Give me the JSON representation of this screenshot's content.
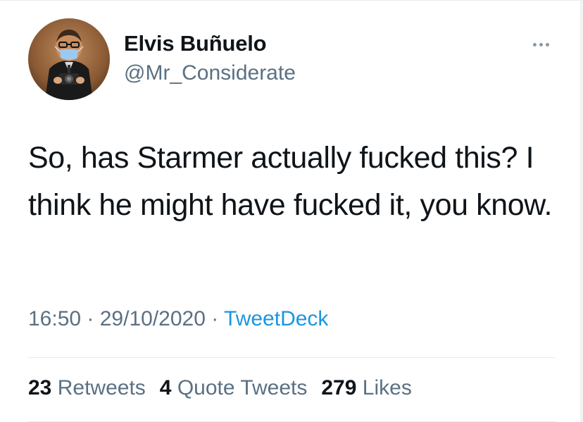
{
  "author": {
    "display_name": "Elvis Buñuelo",
    "handle": "@Mr_Considerate"
  },
  "icons": {
    "avatar": "profile-photo",
    "more": "more-horizontal-icon"
  },
  "tweet": {
    "text": "So, has Starmer actually fucked this? I think he might have fucked it, you know."
  },
  "meta": {
    "time": "16:50",
    "separator": " · ",
    "date": "29/10/2020",
    "source": "TweetDeck"
  },
  "stats": {
    "retweets_count": "23",
    "retweets_label": "Retweets",
    "quote_tweets_count": "4",
    "quote_tweets_label": "Quote Tweets",
    "likes_count": "279",
    "likes_label": "Likes"
  },
  "colors": {
    "text": "#0f1419",
    "secondary": "#5b7083",
    "link": "#1b95e0",
    "divider": "#e6ecf0"
  }
}
